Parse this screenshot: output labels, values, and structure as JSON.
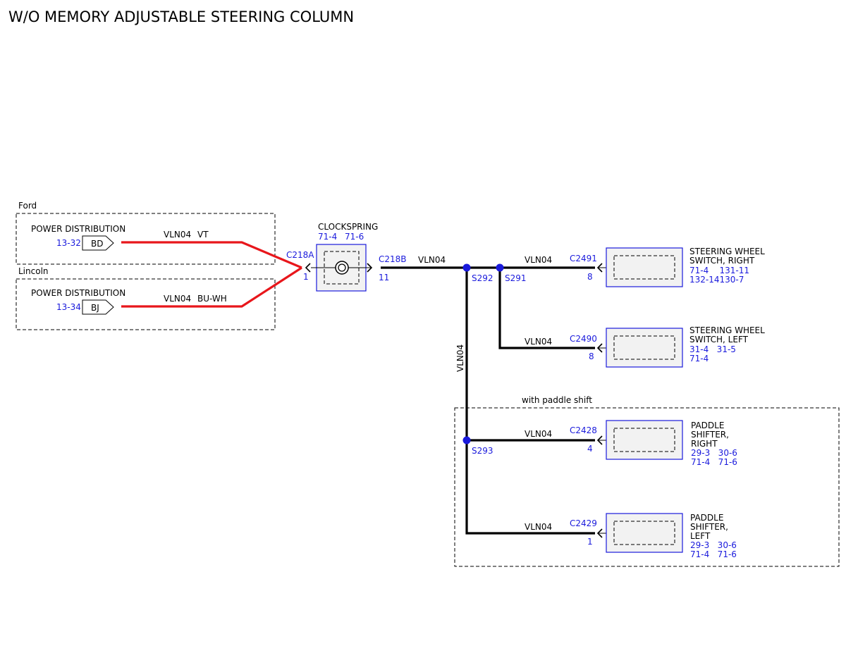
{
  "title": "W/O MEMORY ADJUSTABLE STEERING COLUMN",
  "regions": {
    "ford": "Ford",
    "lincoln": "Lincoln",
    "paddle": "with paddle shift"
  },
  "sources": [
    {
      "name": "POWER DISTRIBUTION",
      "ref": "13-32",
      "tag": "BD",
      "wire": "VLN04",
      "color_code": "VT"
    },
    {
      "name": "POWER DISTRIBUTION",
      "ref": "13-34",
      "tag": "BJ",
      "wire": "VLN04",
      "color_code": "BU-WH"
    }
  ],
  "clockspring": {
    "name": "CLOCKSPRING",
    "refs": [
      "71-4",
      "71-6"
    ],
    "left_connector": "C218A",
    "left_pin": "1",
    "right_connector": "C218B",
    "right_pin": "11",
    "out_wire": "VLN04"
  },
  "splices": [
    "S292",
    "S291",
    "S293"
  ],
  "vertical_wire": "VLN04",
  "components": [
    {
      "wire": "VLN04",
      "connector": "C2491",
      "pin": "8",
      "name_lines": [
        "STEERING WHEEL",
        "SWITCH, RIGHT"
      ],
      "ref_lines": [
        "71-4    131-11",
        "132-14130-7"
      ]
    },
    {
      "wire": "VLN04",
      "connector": "C2490",
      "pin": "8",
      "name_lines": [
        "STEERING WHEEL",
        "SWITCH, LEFT"
      ],
      "ref_lines": [
        "31-4   31-5",
        "71-4"
      ]
    },
    {
      "wire": "VLN04",
      "connector": "C2428",
      "pin": "4",
      "name_lines": [
        "PADDLE",
        "SHIFTER,",
        "RIGHT"
      ],
      "ref_lines": [
        "29-3   30-6",
        "71-4   71-6"
      ]
    },
    {
      "wire": "VLN04",
      "connector": "C2429",
      "pin": "1",
      "name_lines": [
        "PADDLE",
        "SHIFTER,",
        "LEFT"
      ],
      "ref_lines": [
        "29-3   30-6",
        "71-4   71-6"
      ]
    }
  ],
  "colors": {
    "wire": "#000000",
    "source_wire": "#e8161b",
    "reference_text": "#1a1adc",
    "splice": "#1a1adc"
  }
}
